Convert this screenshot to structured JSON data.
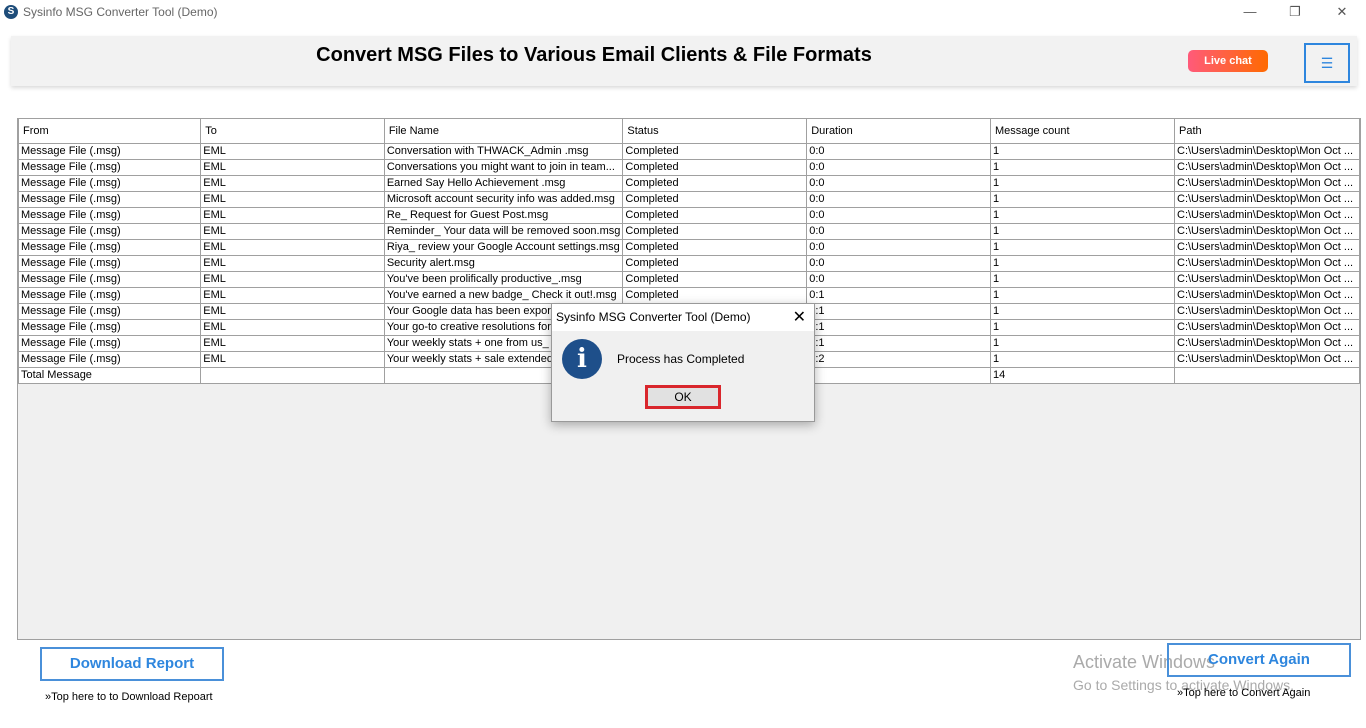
{
  "window": {
    "title": "Sysinfo MSG Converter Tool (Demo)",
    "minimize": "—",
    "restore": "❐",
    "close": "✕"
  },
  "header": {
    "title": "Convert MSG Files to Various Email Clients & File Formats",
    "live_chat": "Live chat",
    "menu_icon": "☰"
  },
  "table": {
    "columns": [
      "From",
      "To",
      "File Name",
      "Status",
      "Duration",
      "Message count",
      "Path"
    ],
    "rows": [
      [
        "Message File (.msg)",
        "EML",
        "Conversation with THWACK_Admin .msg",
        "Completed",
        "0:0",
        "1",
        "C:\\Users\\admin\\Desktop\\Mon Oct ..."
      ],
      [
        "Message File (.msg)",
        "EML",
        "Conversations you might want to join in team...",
        "Completed",
        "0:0",
        "1",
        "C:\\Users\\admin\\Desktop\\Mon Oct ..."
      ],
      [
        "Message File (.msg)",
        "EML",
        "Earned Say Hello Achievement .msg",
        "Completed",
        "0:0",
        "1",
        "C:\\Users\\admin\\Desktop\\Mon Oct ..."
      ],
      [
        "Message File (.msg)",
        "EML",
        "Microsoft account security info was added.msg",
        "Completed",
        "0:0",
        "1",
        "C:\\Users\\admin\\Desktop\\Mon Oct ..."
      ],
      [
        "Message File (.msg)",
        "EML",
        "Re_ Request for Guest Post.msg",
        "Completed",
        "0:0",
        "1",
        "C:\\Users\\admin\\Desktop\\Mon Oct ..."
      ],
      [
        "Message File (.msg)",
        "EML",
        "Reminder_ Your data will be removed soon.msg",
        "Completed",
        "0:0",
        "1",
        "C:\\Users\\admin\\Desktop\\Mon Oct ..."
      ],
      [
        "Message File (.msg)",
        "EML",
        "Riya_ review your Google Account settings.msg",
        "Completed",
        "0:0",
        "1",
        "C:\\Users\\admin\\Desktop\\Mon Oct ..."
      ],
      [
        "Message File (.msg)",
        "EML",
        "Security alert.msg",
        "Completed",
        "0:0",
        "1",
        "C:\\Users\\admin\\Desktop\\Mon Oct ..."
      ],
      [
        "Message File (.msg)",
        "EML",
        "You've been prolifically productive_.msg",
        "Completed",
        "0:0",
        "1",
        "C:\\Users\\admin\\Desktop\\Mon Oct ..."
      ],
      [
        "Message File (.msg)",
        "EML",
        "You've earned a new badge_ Check it out!.msg",
        "Completed",
        "0:1",
        "1",
        "C:\\Users\\admin\\Desktop\\Mon Oct ..."
      ],
      [
        "Message File (.msg)",
        "EML",
        "Your Google data has been export",
        "",
        "0:1",
        "1",
        "C:\\Users\\admin\\Desktop\\Mon Oct ..."
      ],
      [
        "Message File (.msg)",
        "EML",
        "Your go-to creative resolutions for",
        "",
        "0:1",
        "1",
        "C:\\Users\\admin\\Desktop\\Mon Oct ..."
      ],
      [
        "Message File (.msg)",
        "EML",
        "Your weekly stats + one from us_",
        "",
        "0:1",
        "1",
        "C:\\Users\\admin\\Desktop\\Mon Oct ..."
      ],
      [
        "Message File (.msg)",
        "EML",
        "Your weekly stats + sale extended",
        "",
        "0:2",
        "1",
        "C:\\Users\\admin\\Desktop\\Mon Oct ..."
      ]
    ],
    "total_label": "Total Message",
    "total_count": "14"
  },
  "dialog": {
    "title": "Sysinfo MSG Converter Tool (Demo)",
    "message": "Process has Completed",
    "ok": "OK",
    "close": "✕",
    "icon": "i"
  },
  "footer": {
    "download_report": "Download Report",
    "download_hint": "»Top here to to Download Repoart",
    "convert_again": "Convert Again",
    "convert_hint": "»Top here to Convert Again"
  },
  "watermark": {
    "line1": "Activate Windows",
    "line2": "Go to Settings to activate Windows."
  }
}
